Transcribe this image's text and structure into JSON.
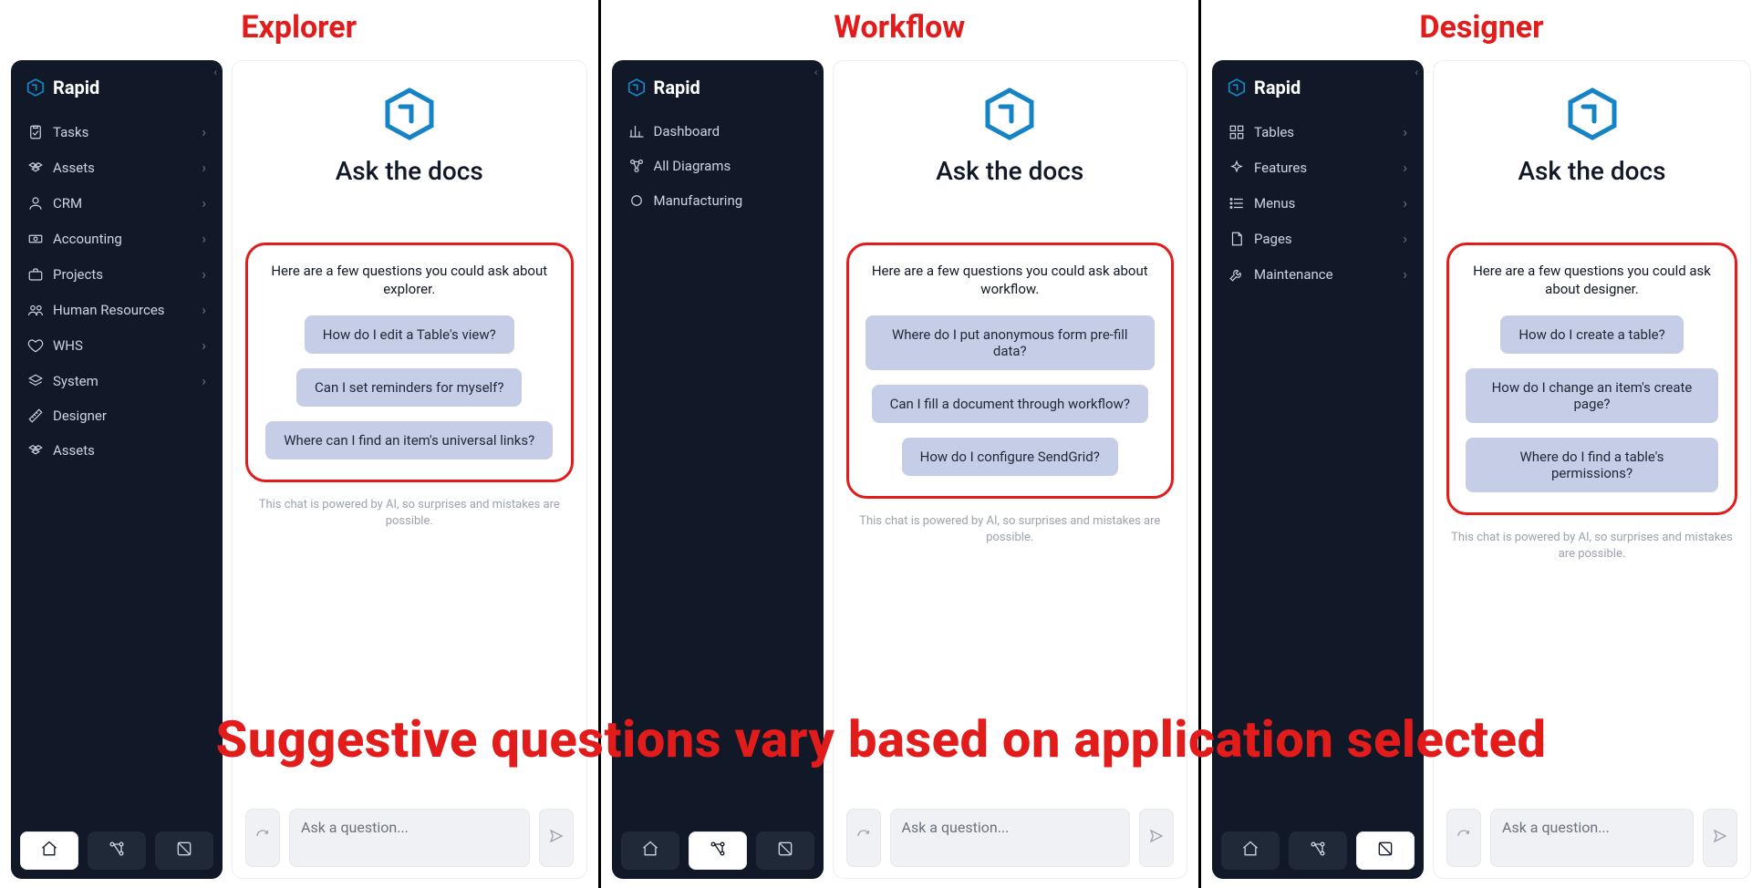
{
  "captions": {
    "big": "Suggestive questions vary based on application selected"
  },
  "hex_logo_stroke": "#1584c6",
  "columns": [
    {
      "title": "Explorer",
      "brand": "Rapid",
      "nav": [
        {
          "label": "Tasks",
          "icon": "clipboard-check-icon",
          "chevron": true
        },
        {
          "label": "Assets",
          "icon": "cubes-icon",
          "chevron": true
        },
        {
          "label": "CRM",
          "icon": "person-icon",
          "chevron": true
        },
        {
          "label": "Accounting",
          "icon": "banknote-icon",
          "chevron": true
        },
        {
          "label": "Projects",
          "icon": "briefcase-icon",
          "chevron": true
        },
        {
          "label": "Human Resources",
          "icon": "people-icon",
          "chevron": true
        },
        {
          "label": "WHS",
          "icon": "heart-icon",
          "chevron": true
        },
        {
          "label": "System",
          "icon": "layers-icon",
          "chevron": true
        },
        {
          "label": "Designer",
          "icon": "ruler-icon",
          "chevron": false
        },
        {
          "label": "Assets",
          "icon": "cubes-icon",
          "chevron": false
        }
      ],
      "footer_active": 0,
      "hero_title": "Ask the docs",
      "suggest_intro": "Here are a few questions you could ask about explorer.",
      "suggestions": [
        "How do I edit a Table's view?",
        "Can I set reminders for myself?",
        "Where can I find an item's universal links?"
      ],
      "disclaimer": "This chat is powered by AI, so surprises and mistakes are possible.",
      "input_placeholder": "Ask a question..."
    },
    {
      "title": "Workflow",
      "brand": "Rapid",
      "nav": [
        {
          "label": "Dashboard",
          "icon": "chart-bar-icon",
          "chevron": false
        },
        {
          "label": "All Diagrams",
          "icon": "flow-icon",
          "chevron": false
        },
        {
          "label": "Manufacturing",
          "icon": "circle-icon",
          "chevron": false
        }
      ],
      "footer_active": 1,
      "hero_title": "Ask the docs",
      "suggest_intro": "Here are a few questions you could ask about workflow.",
      "suggestions": [
        "Where do I put anonymous form pre-fill data?",
        "Can I fill a document through workflow?",
        "How do I configure SendGrid?"
      ],
      "disclaimer": "This chat is powered by AI, so surprises and mistakes are possible.",
      "input_placeholder": "Ask a question..."
    },
    {
      "title": "Designer",
      "brand": "Rapid",
      "nav": [
        {
          "label": "Tables",
          "icon": "grid-icon",
          "chevron": true
        },
        {
          "label": "Features",
          "icon": "sparkle-icon",
          "chevron": true
        },
        {
          "label": "Menus",
          "icon": "list-icon",
          "chevron": true
        },
        {
          "label": "Pages",
          "icon": "page-icon",
          "chevron": true
        },
        {
          "label": "Maintenance",
          "icon": "wrench-icon",
          "chevron": true
        }
      ],
      "footer_active": 2,
      "hero_title": "Ask the docs",
      "suggest_intro": "Here are a few questions you could ask about designer.",
      "suggestions": [
        "How do I create a table?",
        "How do I change an item's create page?",
        "Where do I find a table's permissions?"
      ],
      "disclaimer": "This chat is powered by AI, so surprises and mistakes are possible.",
      "input_placeholder": "Ask a question..."
    }
  ]
}
